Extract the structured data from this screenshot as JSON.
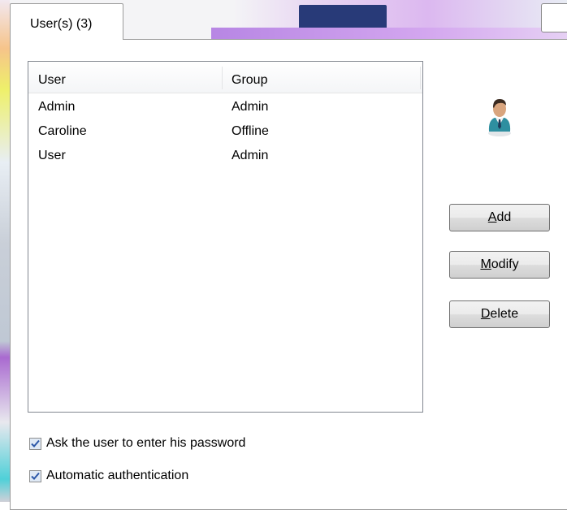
{
  "tab": {
    "label": "User(s) (3)"
  },
  "list": {
    "columns": {
      "user": "User",
      "group": "Group"
    },
    "rows": [
      {
        "user": "Admin",
        "group": "Admin"
      },
      {
        "user": "Caroline",
        "group": "Offline"
      },
      {
        "user": "User",
        "group": "Admin"
      }
    ]
  },
  "buttons": {
    "add": {
      "mnemonic": "A",
      "rest": "dd"
    },
    "modify": {
      "mnemonic": "M",
      "rest": "odify"
    },
    "delete": {
      "mnemonic": "D",
      "rest": "elete"
    }
  },
  "options": {
    "ask_password": {
      "label": "Ask the user to enter his password",
      "checked": true
    },
    "auto_auth": {
      "label": "Automatic authentication",
      "checked": true
    }
  },
  "icons": {
    "avatar": "user-avatar-icon",
    "check": "checkmark-icon"
  },
  "colors": {
    "checkbox_fill": "#dfe9f5",
    "check_mark": "#2b57a8"
  }
}
